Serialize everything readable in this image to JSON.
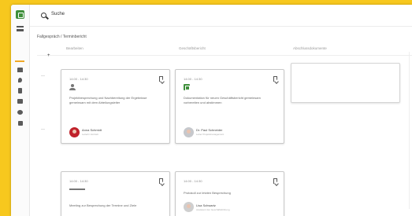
{
  "topbar": {
    "search_label": "Suche"
  },
  "breadcrumb": "Fallgespräch  /  Terminbericht",
  "columns": [
    "Bearbeiten",
    "Geschäftsbericht",
    "Abschlussdokumente"
  ],
  "add_symbol": "+",
  "row_marks": [
    "—",
    "—"
  ],
  "cards": [
    {
      "time": "14:00 - 14:30",
      "desc": "Projektbesprechung und Nachbereitung der Ergebnisse gemeinsam mit dem Abteilungsleiter",
      "author": "Anna Schmidt",
      "author_sub": "Leiterin Vertrieb",
      "avatar_color": "#c0222b"
    },
    {
      "time": "14:00 - 14:30",
      "desc": "Dokumentation für neuen Geschäftsbericht gemeinsam vorbereiten und abstimmen",
      "author": "Dr. Paul Schneider",
      "author_sub": "Leiter Projektmanagement",
      "avatar_color": "#c6c8cc"
    },
    {
      "time": "14:00 - 14:30",
      "desc": "Meeting zur Besprechung der Termine und Ziele",
      "author": "",
      "author_sub": "",
      "avatar_color": "#cccccc"
    },
    {
      "time": "14:00 - 14:30",
      "desc": "Protokoll zur letzten Besprechung",
      "author": "Lisa Schwartz",
      "author_sub": "Assistenz der Geschäftsführung",
      "avatar_color": "#cfcfcf"
    }
  ],
  "colors": {
    "accent": "#f7c81e",
    "brand_green": "#3f8f3b",
    "card_border": "#c9c9c9"
  }
}
